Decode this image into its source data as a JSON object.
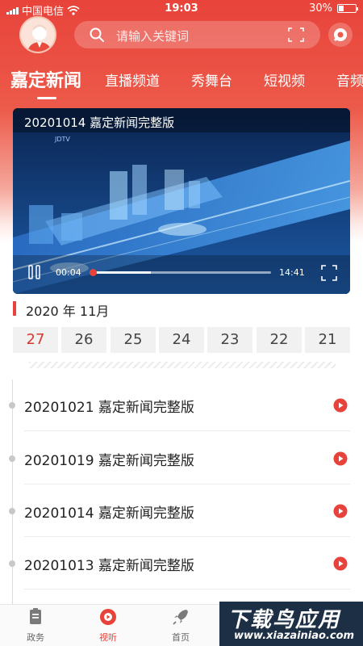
{
  "status_bar": {
    "carrier": "中国电信",
    "time": "19:03",
    "battery": "30%",
    "battery_level": 0.3
  },
  "search": {
    "placeholder": "请输入关键词"
  },
  "tabs": [
    {
      "label": "嘉定新闻"
    },
    {
      "label": "直播频道"
    },
    {
      "label": "秀舞台"
    },
    {
      "label": "短视频"
    },
    {
      "label": "音频"
    }
  ],
  "player": {
    "title": "20201014 嘉定新闻完整版",
    "channel_logo": "JDTV",
    "current_time": "00:04",
    "total_time": "14:41",
    "played_fraction": 0.005,
    "buffered_fraction": 0.33
  },
  "month": "2020 年 11月",
  "days": [
    "27",
    "26",
    "25",
    "24",
    "23",
    "22",
    "21"
  ],
  "selected_day": "27",
  "news": [
    {
      "title": "20201021 嘉定新闻完整版"
    },
    {
      "title": "20201019 嘉定新闻完整版"
    },
    {
      "title": "20201014 嘉定新闻完整版"
    },
    {
      "title": "20201013 嘉定新闻完整版"
    }
  ],
  "bottom_nav": [
    {
      "label": "政务",
      "icon": "document-icon"
    },
    {
      "label": "视听",
      "icon": "play-disc-icon"
    },
    {
      "label": "首页",
      "icon": "rocket-icon"
    }
  ],
  "watermark": {
    "cn": "下载鸟应用",
    "en": "www.xiazainiao.com"
  },
  "colors": {
    "brand": "#e8433a",
    "selected_day": "#d43a30"
  }
}
